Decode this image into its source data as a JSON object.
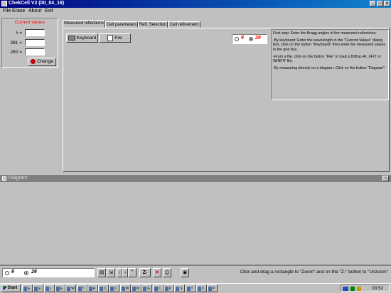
{
  "window": {
    "title": "ChekCell V2 (00_04_16)",
    "controls": {
      "minimize": "_",
      "maximize": "□",
      "close": "×"
    }
  },
  "menu": [
    "File",
    "Erase",
    "About",
    "Exit"
  ],
  "current_values": {
    "heading": "Current values",
    "lambda_label": "λ =",
    "theta1_label": "2θ1 =",
    "theta2_label": "2θ2 =",
    "change_button": "Change"
  },
  "tabs": [
    "Measured reflections",
    "Cell parameters",
    "Refl. Selection",
    "Cell refinement"
  ],
  "measured": {
    "keyboard_button": "Keyboard",
    "file_button": "File"
  },
  "angle_mode": {
    "theta": "θ",
    "two_theta": "2θ",
    "selected": "2θ"
  },
  "help_text": [
    "First step: Enter the Bragg angles of the measured reflections:",
    "-By keyboard: Enter the wavelength in the \"Current Values\" dialog box, click on the button \"Keyboard\" then enter  the measured values in the grid box.",
    "-From a  file, click on the  button \"File\" to load a Diffrac-At, XFIT or WINFIT file.",
    "-By measuring directly on a diagram. Click on the button \"Diagram\"."
  ],
  "diagram": {
    "title": "Diagram",
    "zoom_out_label": "Z-",
    "hint": "Click and drag a rectangle to \"Zoom\" and  on the \"Z-\" button to \"Unzoom\""
  },
  "taskbar": {
    "start": "Start",
    "tasks": [
      "E",
      "E",
      "L",
      "E",
      "W",
      "T",
      "A",
      "C",
      "C",
      "W",
      "M",
      "G",
      "C",
      "P",
      "S",
      "T",
      "C.",
      "P"
    ],
    "clock": "03:52"
  },
  "colors": {
    "title_bar": "#000080",
    "heading_red": "#ff0000",
    "face": "#c0c0c0",
    "desktop": "#008080"
  }
}
